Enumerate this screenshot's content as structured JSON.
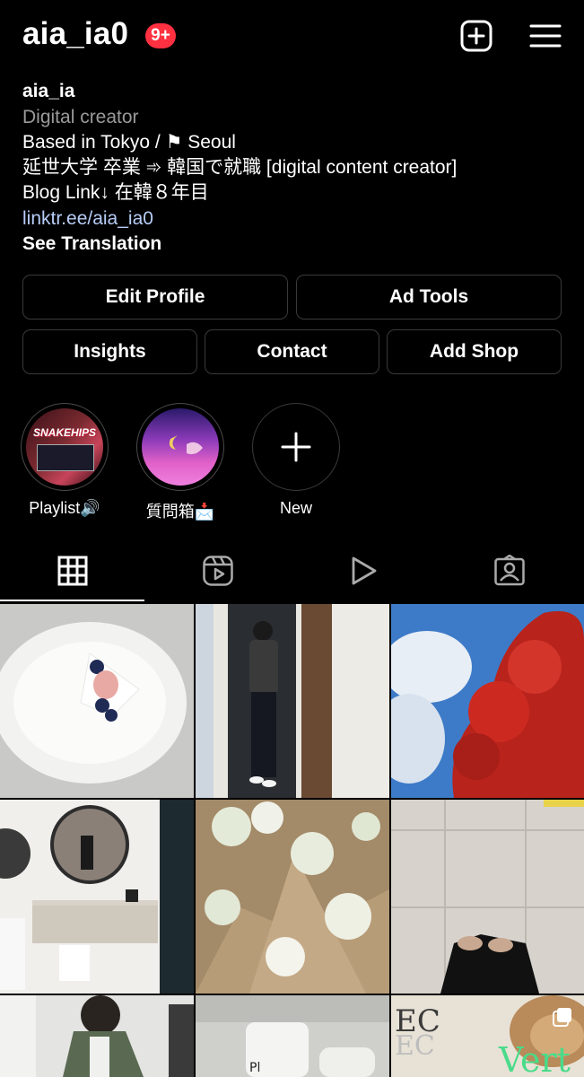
{
  "header": {
    "username": "aia_ia0",
    "notification_badge": "9+",
    "icons": [
      "add-post-icon",
      "menu-icon"
    ]
  },
  "bio": {
    "name": "aia_ia",
    "category": "Digital creator",
    "lines": [
      "Based in Tokyo / ⚑ Seoul",
      "延世大学 卒業 ➾ 韓国で就職 [digital content creator]",
      "Blog Link↓ 在韓８年目"
    ],
    "link": "linktr.ee/aia_ia0",
    "see_translation": "See Translation"
  },
  "buttons": {
    "edit_profile": "Edit Profile",
    "ad_tools": "Ad Tools",
    "insights": "Insights",
    "contact": "Contact",
    "add_shop": "Add Shop"
  },
  "highlights": [
    {
      "label": "Playlist🔊",
      "cover_text": "SNAKEHIPS"
    },
    {
      "label": "質問箱📩",
      "cover_text": ""
    },
    {
      "label": "New"
    }
  ],
  "tabs": [
    "grid-icon",
    "reels-icon",
    "play-icon",
    "tagged-icon"
  ],
  "grid_posts": [
    {
      "subject": "dessert on white plate"
    },
    {
      "subject": "person in doorway"
    },
    {
      "subject": "red maple tree and sky"
    },
    {
      "subject": "bathroom mirror"
    },
    {
      "subject": "white flower bouquets"
    },
    {
      "subject": "feet on stone tiles"
    },
    {
      "subject": "person in green coat"
    },
    {
      "subject": "product bottles"
    },
    {
      "subject": "cafe magazine",
      "overlay_text": "Vert",
      "multi_icon": "carousel-icon"
    }
  ],
  "colors": {
    "badge": "#ff3040",
    "link": "#b7cdf8",
    "secondary_text": "#9a9a9a",
    "button_border": "#3a3a3a"
  }
}
